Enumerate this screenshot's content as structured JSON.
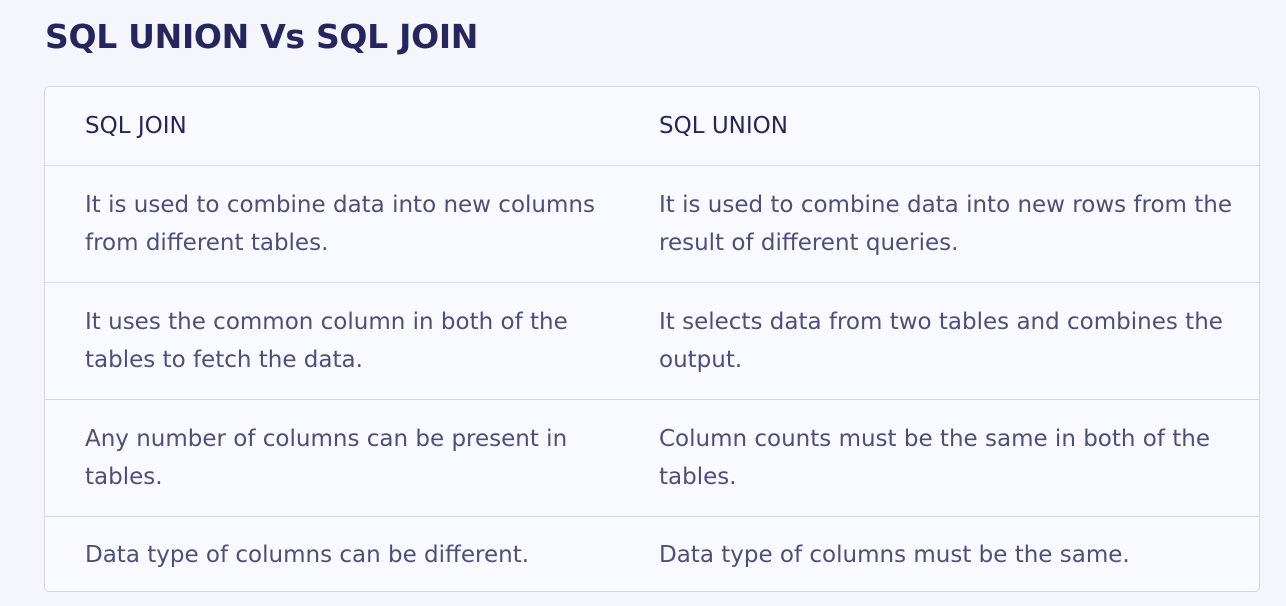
{
  "page": {
    "title": "SQL UNION Vs SQL JOIN"
  },
  "table": {
    "headers": [
      "SQL JOIN",
      "SQL UNION"
    ],
    "rows": [
      [
        "It is used to combine data into new columns from different tables.",
        "It is used to combine data into new rows from the result of different queries."
      ],
      [
        "It uses the common column in both of the tables to fetch the data.",
        "It selects data from two tables and combines the output."
      ],
      [
        "Any number of columns can be present in tables.",
        "Column counts must be the same in both of the tables."
      ],
      [
        "Data type of columns can be different.",
        "Data type of columns must be the same."
      ]
    ]
  },
  "colors": {
    "heading": "#25265e",
    "body_text": "#4d4f7b",
    "border": "#d3d7e6",
    "table_bg": "#f9faff",
    "page_bg": "#f4f6fb"
  }
}
